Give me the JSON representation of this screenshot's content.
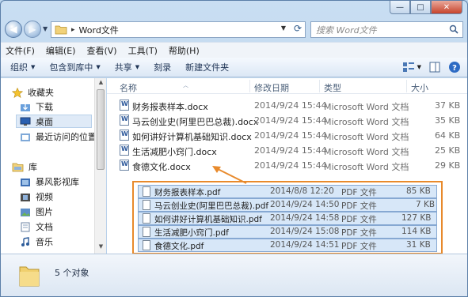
{
  "window": {
    "caption": {
      "minimize": "—",
      "maximize": "□",
      "close": "✕"
    }
  },
  "address": {
    "path_separator": "▸",
    "folder": "Word文件",
    "search_placeholder": "搜索 Word文件"
  },
  "menu": [
    "文件(F)",
    "编辑(E)",
    "查看(V)",
    "工具(T)",
    "帮助(H)"
  ],
  "toolbar": {
    "organize": "组织",
    "include_in_library": "包含到库中",
    "share": "共享",
    "burn": "刻录",
    "new_folder": "新建文件夹"
  },
  "nav": {
    "favorites": "收藏夹",
    "downloads": "下载",
    "desktop": "桌面",
    "recent": "最近访问的位置",
    "libraries": "库",
    "storm_video": "暴风影视库",
    "videos": "视频",
    "pictures": "图片",
    "documents": "文档",
    "music": "音乐"
  },
  "columns": {
    "name": "名称",
    "modified": "修改日期",
    "type": "类型",
    "size": "大小"
  },
  "word_files": [
    {
      "name": "财务报表样本.docx",
      "date": "2014/9/24 15:44",
      "type": "Microsoft Word 文档",
      "size": "37 KB"
    },
    {
      "name": "马云创业史(阿里巴巴总裁).docx",
      "date": "2014/9/24 15:44",
      "type": "Microsoft Word 文档",
      "size": "35 KB"
    },
    {
      "name": "如何讲好计算机基础知识.docx",
      "date": "2014/9/24 15:44",
      "type": "Microsoft Word 文档",
      "size": "64 KB"
    },
    {
      "name": "生活减肥小窍门.docx",
      "date": "2014/9/24 15:44",
      "type": "Microsoft Word 文档",
      "size": "25 KB"
    },
    {
      "name": "食德文化.docx",
      "date": "2014/9/24 15:44",
      "type": "Microsoft Word 文档",
      "size": "29 KB"
    }
  ],
  "pdf_files": [
    {
      "name": "财务报表样本.pdf",
      "date": "2014/8/8 12:20",
      "type": "PDF 文件",
      "size": "85 KB"
    },
    {
      "name": "马云创业史(阿里巴巴总裁).pdf",
      "date": "2014/9/24 14:50",
      "type": "PDF 文件",
      "size": "7 KB"
    },
    {
      "name": "如何讲好计算机基础知识.pdf",
      "date": "2014/9/24 14:58",
      "type": "PDF 文件",
      "size": "127 KB"
    },
    {
      "name": "生活减肥小窍门.pdf",
      "date": "2014/9/24 15:08",
      "type": "PDF 文件",
      "size": "114 KB"
    },
    {
      "name": "食德文化.pdf",
      "date": "2014/9/24 14:51",
      "type": "PDF 文件",
      "size": "31 KB"
    }
  ],
  "status": {
    "count_text": "5 个对象"
  },
  "colors": {
    "highlight_border": "#e88a2c",
    "selection_fill": "#d7e7f8"
  }
}
